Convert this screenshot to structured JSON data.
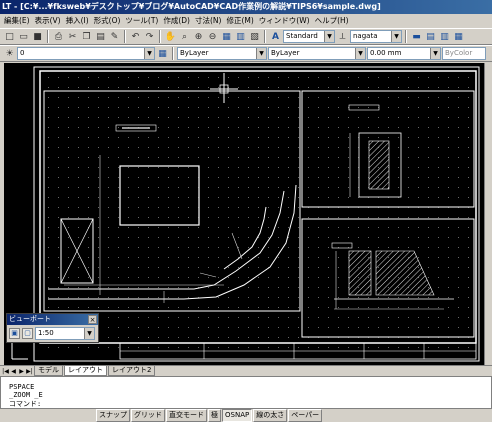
{
  "window": {
    "title": "LT - [C:¥...¥fksweb¥デスクトップ¥ブログ¥AutoCAD¥CAD作業例の解説¥TIPS6¥sample.dwg]"
  },
  "menu": [
    "編集(E)",
    "表示(V)",
    "挿入(I)",
    "形式(O)",
    "ツール(T)",
    "作成(D)",
    "寸法(N)",
    "修正(M)",
    "ウィンドウ(W)",
    "ヘルプ(H)"
  ],
  "toolbar1": {
    "text_style": "Standard",
    "dim_style": "nagata"
  },
  "toolbar2": {
    "layer": "0",
    "color": "ByLayer",
    "linetype": "ByLayer",
    "lineweight": "0.00 mm",
    "plotstyle": "ByColor"
  },
  "tabs": {
    "items": [
      "モデル",
      "レイアウト",
      "レイアウト2"
    ],
    "active_index": 1
  },
  "command": {
    "line1": "PSPACE",
    "line2": "_ZOOM  _E",
    "prompt": "コマンド:"
  },
  "status_buttons": [
    {
      "label": "スナップ",
      "on": false
    },
    {
      "label": "グリッド",
      "on": false
    },
    {
      "label": "直交モード",
      "on": false
    },
    {
      "label": "極",
      "on": false
    },
    {
      "label": "OSNAP",
      "on": true
    },
    {
      "label": "線の太さ",
      "on": false
    },
    {
      "label": "ペーパー",
      "on": false
    }
  ],
  "viewport_toolbar": {
    "title": "ビューポート",
    "scale": "1:50"
  },
  "icons": [
    "new-icon",
    "open-icon",
    "save-icon",
    "print-icon",
    "cut-icon",
    "copy-icon",
    "paste-icon",
    "undo-icon",
    "redo-icon",
    "pan-icon",
    "zoom-icon",
    "layer-icon",
    "properties-icon"
  ]
}
